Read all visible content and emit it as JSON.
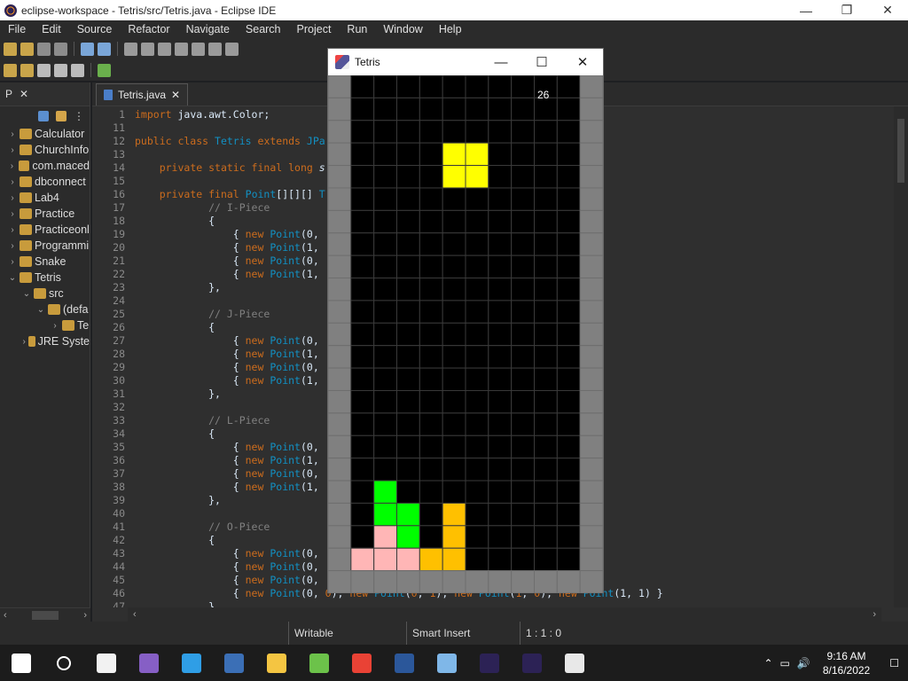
{
  "window": {
    "title": "eclipse-workspace - Tetris/src/Tetris.java - Eclipse IDE",
    "minimize": "—",
    "maximize": "❐",
    "close": "✕"
  },
  "menu": [
    "File",
    "Edit",
    "Source",
    "Refactor",
    "Navigate",
    "Search",
    "Project",
    "Run",
    "Window",
    "Help"
  ],
  "package_explorer": {
    "tab_label": "P",
    "tab_close": "✕",
    "items": [
      {
        "label": "Calculator",
        "arrow": "›",
        "indent": 0
      },
      {
        "label": "ChurchInfo",
        "arrow": "›",
        "indent": 0
      },
      {
        "label": "com.maced",
        "arrow": "›",
        "indent": 0
      },
      {
        "label": "dbconnect",
        "arrow": "›",
        "indent": 0
      },
      {
        "label": "Lab4",
        "arrow": "›",
        "indent": 0
      },
      {
        "label": "Practice",
        "arrow": "›",
        "indent": 0
      },
      {
        "label": "Practiceonl",
        "arrow": "›",
        "indent": 0
      },
      {
        "label": "Programmi",
        "arrow": "›",
        "indent": 0
      },
      {
        "label": "Snake",
        "arrow": "›",
        "indent": 0
      },
      {
        "label": "Tetris",
        "arrow": "⌄",
        "indent": 0
      },
      {
        "label": "src",
        "arrow": "⌄",
        "indent": 1
      },
      {
        "label": "(defa",
        "arrow": "⌄",
        "indent": 2
      },
      {
        "label": "Te",
        "arrow": "›",
        "indent": 3
      },
      {
        "label": "JRE Syste",
        "arrow": "›",
        "indent": 1
      }
    ]
  },
  "editor": {
    "tab_label": "Tetris.java",
    "tab_close": "✕",
    "lines": [
      {
        "n": "1",
        "html": "<span class=\"kw\">import</span> java.awt.Color;"
      },
      {
        "n": "11",
        "html": ""
      },
      {
        "n": "12",
        "html": "<span class=\"kw\">public class</span> <span class=\"ty\">Tetris</span> <span class=\"kw\">extends</span> <span class=\"ty\">JPa</span>"
      },
      {
        "n": "13",
        "html": ""
      },
      {
        "n": "14",
        "html": "    <span class=\"kw\">private static final long</span> <span class=\"sv\">s</span>"
      },
      {
        "n": "15",
        "html": ""
      },
      {
        "n": "16",
        "html": "    <span class=\"kw\">private final</span> <span class=\"ty\">Point</span>[][][] <span class=\"ty\">T</span>"
      },
      {
        "n": "17",
        "html": "            <span class=\"cm\">// I-Piece</span>"
      },
      {
        "n": "18",
        "html": "            {"
      },
      {
        "n": "19",
        "html": "                { <span class=\"kw\">new</span> <span class=\"ty\">Point</span>(0,                            <span class=\"ty\">int</span>(3, 1) },"
      },
      {
        "n": "20",
        "html": "                { <span class=\"kw\">new</span> <span class=\"ty\">Point</span>(1,                            <span class=\"ty\">int</span>(1, 3) },"
      },
      {
        "n": "21",
        "html": "                { <span class=\"kw\">new</span> <span class=\"ty\">Point</span>(0,                            <span class=\"ty\">int</span>(3, 1) },"
      },
      {
        "n": "22",
        "html": "                { <span class=\"kw\">new</span> <span class=\"ty\">Point</span>(1,                            <span class=\"ty\">int</span>(1, 3) }"
      },
      {
        "n": "23",
        "html": "            },"
      },
      {
        "n": "24",
        "html": ""
      },
      {
        "n": "25",
        "html": "            <span class=\"cm\">// J-Piece</span>"
      },
      {
        "n": "26",
        "html": "            {"
      },
      {
        "n": "27",
        "html": "                { <span class=\"kw\">new</span> <span class=\"ty\">Point</span>(0,                            <span class=\"ty\">int</span>(2, 0) },"
      },
      {
        "n": "28",
        "html": "                { <span class=\"kw\">new</span> <span class=\"ty\">Point</span>(1,                            <span class=\"ty\">int</span>(2, 2) },"
      },
      {
        "n": "29",
        "html": "                { <span class=\"kw\">new</span> <span class=\"ty\">Point</span>(0,                            <span class=\"ty\">int</span>(0, 2) },"
      },
      {
        "n": "30",
        "html": "                { <span class=\"kw\">new</span> <span class=\"ty\">Point</span>(1,                            <span class=\"ty\">int</span>(0, 0) }"
      },
      {
        "n": "31",
        "html": "            },"
      },
      {
        "n": "32",
        "html": ""
      },
      {
        "n": "33",
        "html": "            <span class=\"cm\">// L-Piece</span>"
      },
      {
        "n": "34",
        "html": "            {"
      },
      {
        "n": "35",
        "html": "                { <span class=\"kw\">new</span> <span class=\"ty\">Point</span>(0,                            <span class=\"ty\">int</span>(2, 2) },"
      },
      {
        "n": "36",
        "html": "                { <span class=\"kw\">new</span> <span class=\"ty\">Point</span>(1,                            <span class=\"ty\">int</span>(0, 2) },"
      },
      {
        "n": "37",
        "html": "                { <span class=\"kw\">new</span> <span class=\"ty\">Point</span>(0,                            <span class=\"ty\">int</span>(0, 0) },"
      },
      {
        "n": "38",
        "html": "                { <span class=\"kw\">new</span> <span class=\"ty\">Point</span>(1,                            <span class=\"ty\">int</span>(2, 0) }"
      },
      {
        "n": "39",
        "html": "            },"
      },
      {
        "n": "40",
        "html": ""
      },
      {
        "n": "41",
        "html": "            <span class=\"cm\">// O-Piece</span>"
      },
      {
        "n": "42",
        "html": "            {"
      },
      {
        "n": "43",
        "html": "                { <span class=\"kw\">new</span> <span class=\"ty\">Point</span>(0,                            <span class=\"ty\">int</span>(1, 1) },"
      },
      {
        "n": "44",
        "html": "                { <span class=\"kw\">new</span> <span class=\"ty\">Point</span>(0,                            <span class=\"ty\">int</span>(1, 1) },"
      },
      {
        "n": "45",
        "html": "                { <span class=\"kw\">new</span> <span class=\"ty\">Point</span>(0,                            <span class=\"ty\">int</span>(1, 1) },"
      },
      {
        "n": "46",
        "html": "                { <span class=\"kw\">new</span> <span class=\"ty\">Point</span>(0, <span class=\"kw\">0</span>), <span class=\"kw\">new</span> <span class=\"ty\">Point</span>(<span class=\"kw\">0</span>, <span class=\"kw\">1</span>), <span class=\"kw\">new</span> <span class=\"ty\">Point</span>(<span class=\"kw\">1</span>, <span class=\"kw\">0</span>), <span class=\"kw\">new</span> <span class=\"ty\">Point</span>(1, 1) }"
      },
      {
        "n": "47",
        "html": "            }"
      }
    ]
  },
  "status": {
    "writable": "Writable",
    "insert_mode": "Smart Insert",
    "position": "1 : 1 : 0"
  },
  "tetris_window": {
    "title": "Tetris",
    "minimize": "—",
    "maximize": "☐",
    "close": "✕",
    "score": "26",
    "cols": 12,
    "rows": 23,
    "wall_color": "#808080",
    "empty_color": "#000000",
    "cells": [
      {
        "c": 5,
        "r": 3,
        "color": "#ffff00"
      },
      {
        "c": 6,
        "r": 3,
        "color": "#ffff00"
      },
      {
        "c": 5,
        "r": 4,
        "color": "#ffff00"
      },
      {
        "c": 6,
        "r": 4,
        "color": "#ffff00"
      },
      {
        "c": 2,
        "r": 18,
        "color": "#00ff00"
      },
      {
        "c": 2,
        "r": 19,
        "color": "#00ff00"
      },
      {
        "c": 3,
        "r": 19,
        "color": "#00ff00"
      },
      {
        "c": 3,
        "r": 20,
        "color": "#00ff00"
      },
      {
        "c": 2,
        "r": 20,
        "color": "#ffb6b6"
      },
      {
        "c": 1,
        "r": 21,
        "color": "#ffb6b6"
      },
      {
        "c": 2,
        "r": 21,
        "color": "#ffb6b6"
      },
      {
        "c": 3,
        "r": 21,
        "color": "#ffb6b6"
      },
      {
        "c": 5,
        "r": 19,
        "color": "#ffc000"
      },
      {
        "c": 5,
        "r": 20,
        "color": "#ffc000"
      },
      {
        "c": 4,
        "r": 21,
        "color": "#ffc000"
      },
      {
        "c": 5,
        "r": 21,
        "color": "#ffc000"
      }
    ]
  },
  "taskbar": {
    "apps": [
      {
        "name": "start-icon",
        "color": "#ffffff"
      },
      {
        "name": "search-icon",
        "color": "#ffffff"
      },
      {
        "name": "file-icon",
        "color": "#f2f2f2"
      },
      {
        "name": "visual-studio-icon",
        "color": "#865fc5"
      },
      {
        "name": "edge-icon",
        "color": "#2f9ee6"
      },
      {
        "name": "matlab-icon",
        "color": "#3b6fb6"
      },
      {
        "name": "file-explorer-icon",
        "color": "#f4c542"
      },
      {
        "name": "music-app-icon",
        "color": "#6cc24a"
      },
      {
        "name": "chrome-icon",
        "color": "#e94235"
      },
      {
        "name": "word-icon",
        "color": "#2b579a"
      },
      {
        "name": "paint-icon",
        "color": "#7fb7e8"
      },
      {
        "name": "eclipse-icon",
        "color": "#2c2255"
      },
      {
        "name": "eclipse-icon-2",
        "color": "#2c2255"
      },
      {
        "name": "java-icon",
        "color": "#e8e8e8"
      }
    ],
    "time": "9:16 AM",
    "date": "8/16/2022"
  }
}
